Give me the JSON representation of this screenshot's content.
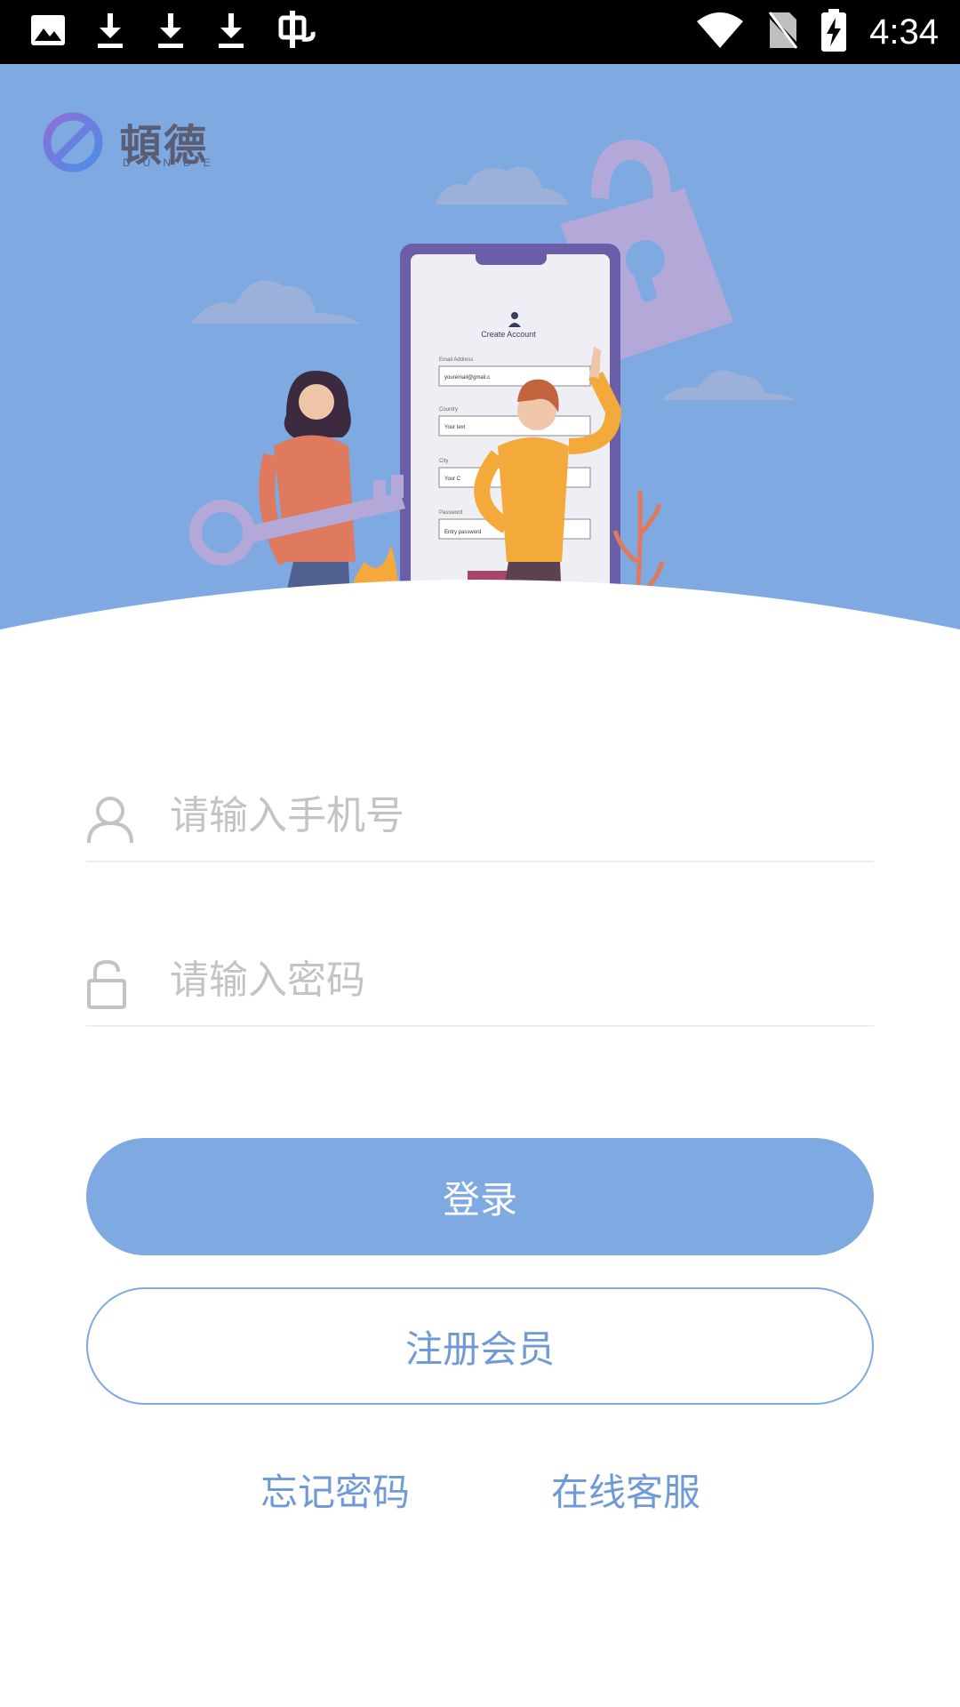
{
  "status_bar": {
    "time": "4:34",
    "left_icons": [
      "image-icon",
      "download-icon",
      "download-icon",
      "download-icon",
      "app-notify-icon"
    ],
    "right_icons": [
      "wifi-icon",
      "no-sim-icon",
      "battery-charging-icon"
    ]
  },
  "brand": {
    "name": "頓德",
    "subtitle": "DUNDE"
  },
  "illustration": {
    "form_title": "Create Account",
    "email_label": "Email Address",
    "email_value": "youremail@gmail.c",
    "country_label": "Country",
    "country_value": "Your text",
    "city_label": "City",
    "city_value": "Your C",
    "password_label": "Password",
    "password_value": "Entry password"
  },
  "login_form": {
    "phone_placeholder": "请输入手机号",
    "password_placeholder": "请输入密码",
    "login_label": "登录",
    "register_label": "注册会员",
    "forgot_label": "忘记密码",
    "support_label": "在线客服"
  },
  "colors": {
    "accent": "#7ea9e1",
    "link": "#6f9ad6"
  }
}
